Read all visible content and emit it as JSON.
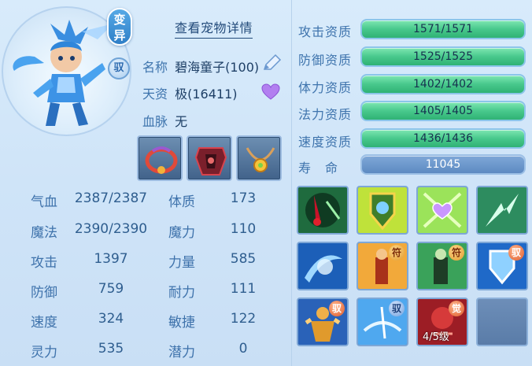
{
  "pet": {
    "mutate_label": "变异",
    "tame_label": "驭",
    "detail_link": "查看宠物详情",
    "name_label": "名称",
    "name_value": "碧海童子(100)",
    "talent_label": "天资",
    "talent_value": "极(16411)",
    "bloodline_label": "血脉",
    "bloodline_value": "无"
  },
  "equipment": [
    {
      "name": "collar-equip"
    },
    {
      "name": "armor-equip"
    },
    {
      "name": "necklace-equip"
    }
  ],
  "attributes": {
    "hp_label": "气血",
    "hp_value": "2387/2387",
    "mp_label": "魔法",
    "mp_value": "2390/2390",
    "atk_label": "攻击",
    "atk_value": "1397",
    "def_label": "防御",
    "def_value": "759",
    "spd_label": "速度",
    "spd_value": "324",
    "spi_label": "灵力",
    "spi_value": "535",
    "con_label": "体质",
    "con_value": "173",
    "mag_label": "魔力",
    "mag_value": "110",
    "str_label": "力量",
    "str_value": "585",
    "end_label": "耐力",
    "end_value": "111",
    "agi_label": "敏捷",
    "agi_value": "122",
    "pot_label": "潜力",
    "pot_value": "0"
  },
  "aptitudes": [
    {
      "label": "攻击资质",
      "value": "1571/1571"
    },
    {
      "label": "防御资质",
      "value": "1525/1525"
    },
    {
      "label": "体力资质",
      "value": "1402/1402"
    },
    {
      "label": "法力资质",
      "value": "1405/1405"
    },
    {
      "label": "速度资质",
      "value": "1436/1436"
    }
  ],
  "lifespan": {
    "label": "寿　命",
    "value": "11045"
  },
  "skills": {
    "fu_char": "符",
    "yu_char": "驭",
    "jue_char": "觉",
    "awaken_level": "4/5级"
  },
  "colors": {
    "bar_green": "#48c88c",
    "bar_blue": "#5d8ac2",
    "text_blue": "#3e74ad"
  }
}
